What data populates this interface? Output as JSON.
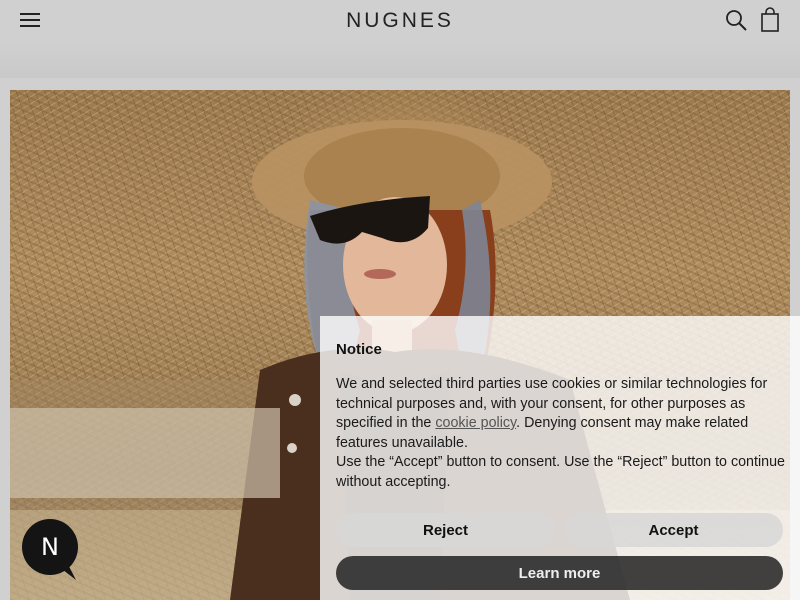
{
  "header": {
    "brand": "NUGNES"
  },
  "cookie_notice": {
    "title": "Notice",
    "body_before_link": "We and selected third parties use cookies or similar technologies for technical purposes and, with your consent, for other purposes as specified in the ",
    "link_text": "cookie policy",
    "body_after_link": ". Denying consent may make related features unavailable.",
    "body_second": "Use the “Accept” button to consent. Use the “Reject” button to continue without accepting.",
    "reject_label": "Reject",
    "accept_label": "Accept",
    "learn_more_label": "Learn more"
  },
  "chat": {
    "badge_letter": "N"
  },
  "icons": {
    "menu": "hamburger-menu-icon",
    "search": "search-icon",
    "bag": "shopping-bag-icon",
    "chat": "chat-icon"
  }
}
